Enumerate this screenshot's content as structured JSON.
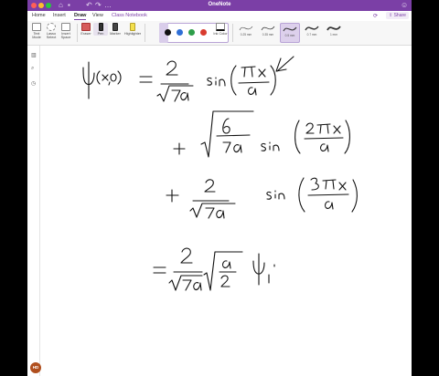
{
  "app": {
    "title": "OneNote"
  },
  "menus": {
    "home": "Home",
    "insert": "Insert",
    "draw": "Draw",
    "view": "View",
    "class_notebook": "Class Notebook"
  },
  "share_label": "Share",
  "ribbon": {
    "text_mode": "Text Mode",
    "lasso_select": "Lasso Select",
    "insert_space": "Insert Space",
    "eraser": "Eraser",
    "pen": "Pen",
    "marker": "Marker",
    "highlighter": "Highlighter",
    "ink_color": "Ink Color",
    "pen_colors": [
      "#111111",
      "#2f6fd6",
      "#2e9e4a",
      "#d83b2e"
    ],
    "thickness": [
      "0.25 mm",
      "0.35 mm",
      "0.5 mm",
      "0.7 mm",
      "1 mm"
    ],
    "selected_thickness": "0.5 mm"
  },
  "user": {
    "initials": "HD"
  }
}
